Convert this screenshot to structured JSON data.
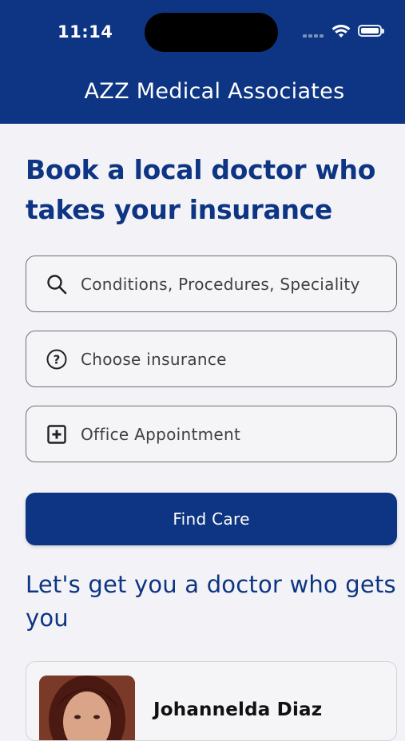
{
  "status_bar": {
    "time": "11:14"
  },
  "header": {
    "title": "AZZ Medical Associates"
  },
  "main": {
    "heading": "Book a local doctor who takes your insurance",
    "search": {
      "placeholder": "Conditions, Procedures, Speciality",
      "icon": "search-icon"
    },
    "insurance": {
      "label": "Choose insurance",
      "icon": "question-circle-icon"
    },
    "visit_type": {
      "label": "Office Appointment",
      "icon": "plus-square-icon"
    },
    "find_button": "Find Care",
    "subheading": "Let's get you a doctor who gets you"
  },
  "doctors": [
    {
      "name": "Johannelda Diaz"
    }
  ],
  "colors": {
    "brand": "#0d3583",
    "background": "#f3f3f7"
  }
}
